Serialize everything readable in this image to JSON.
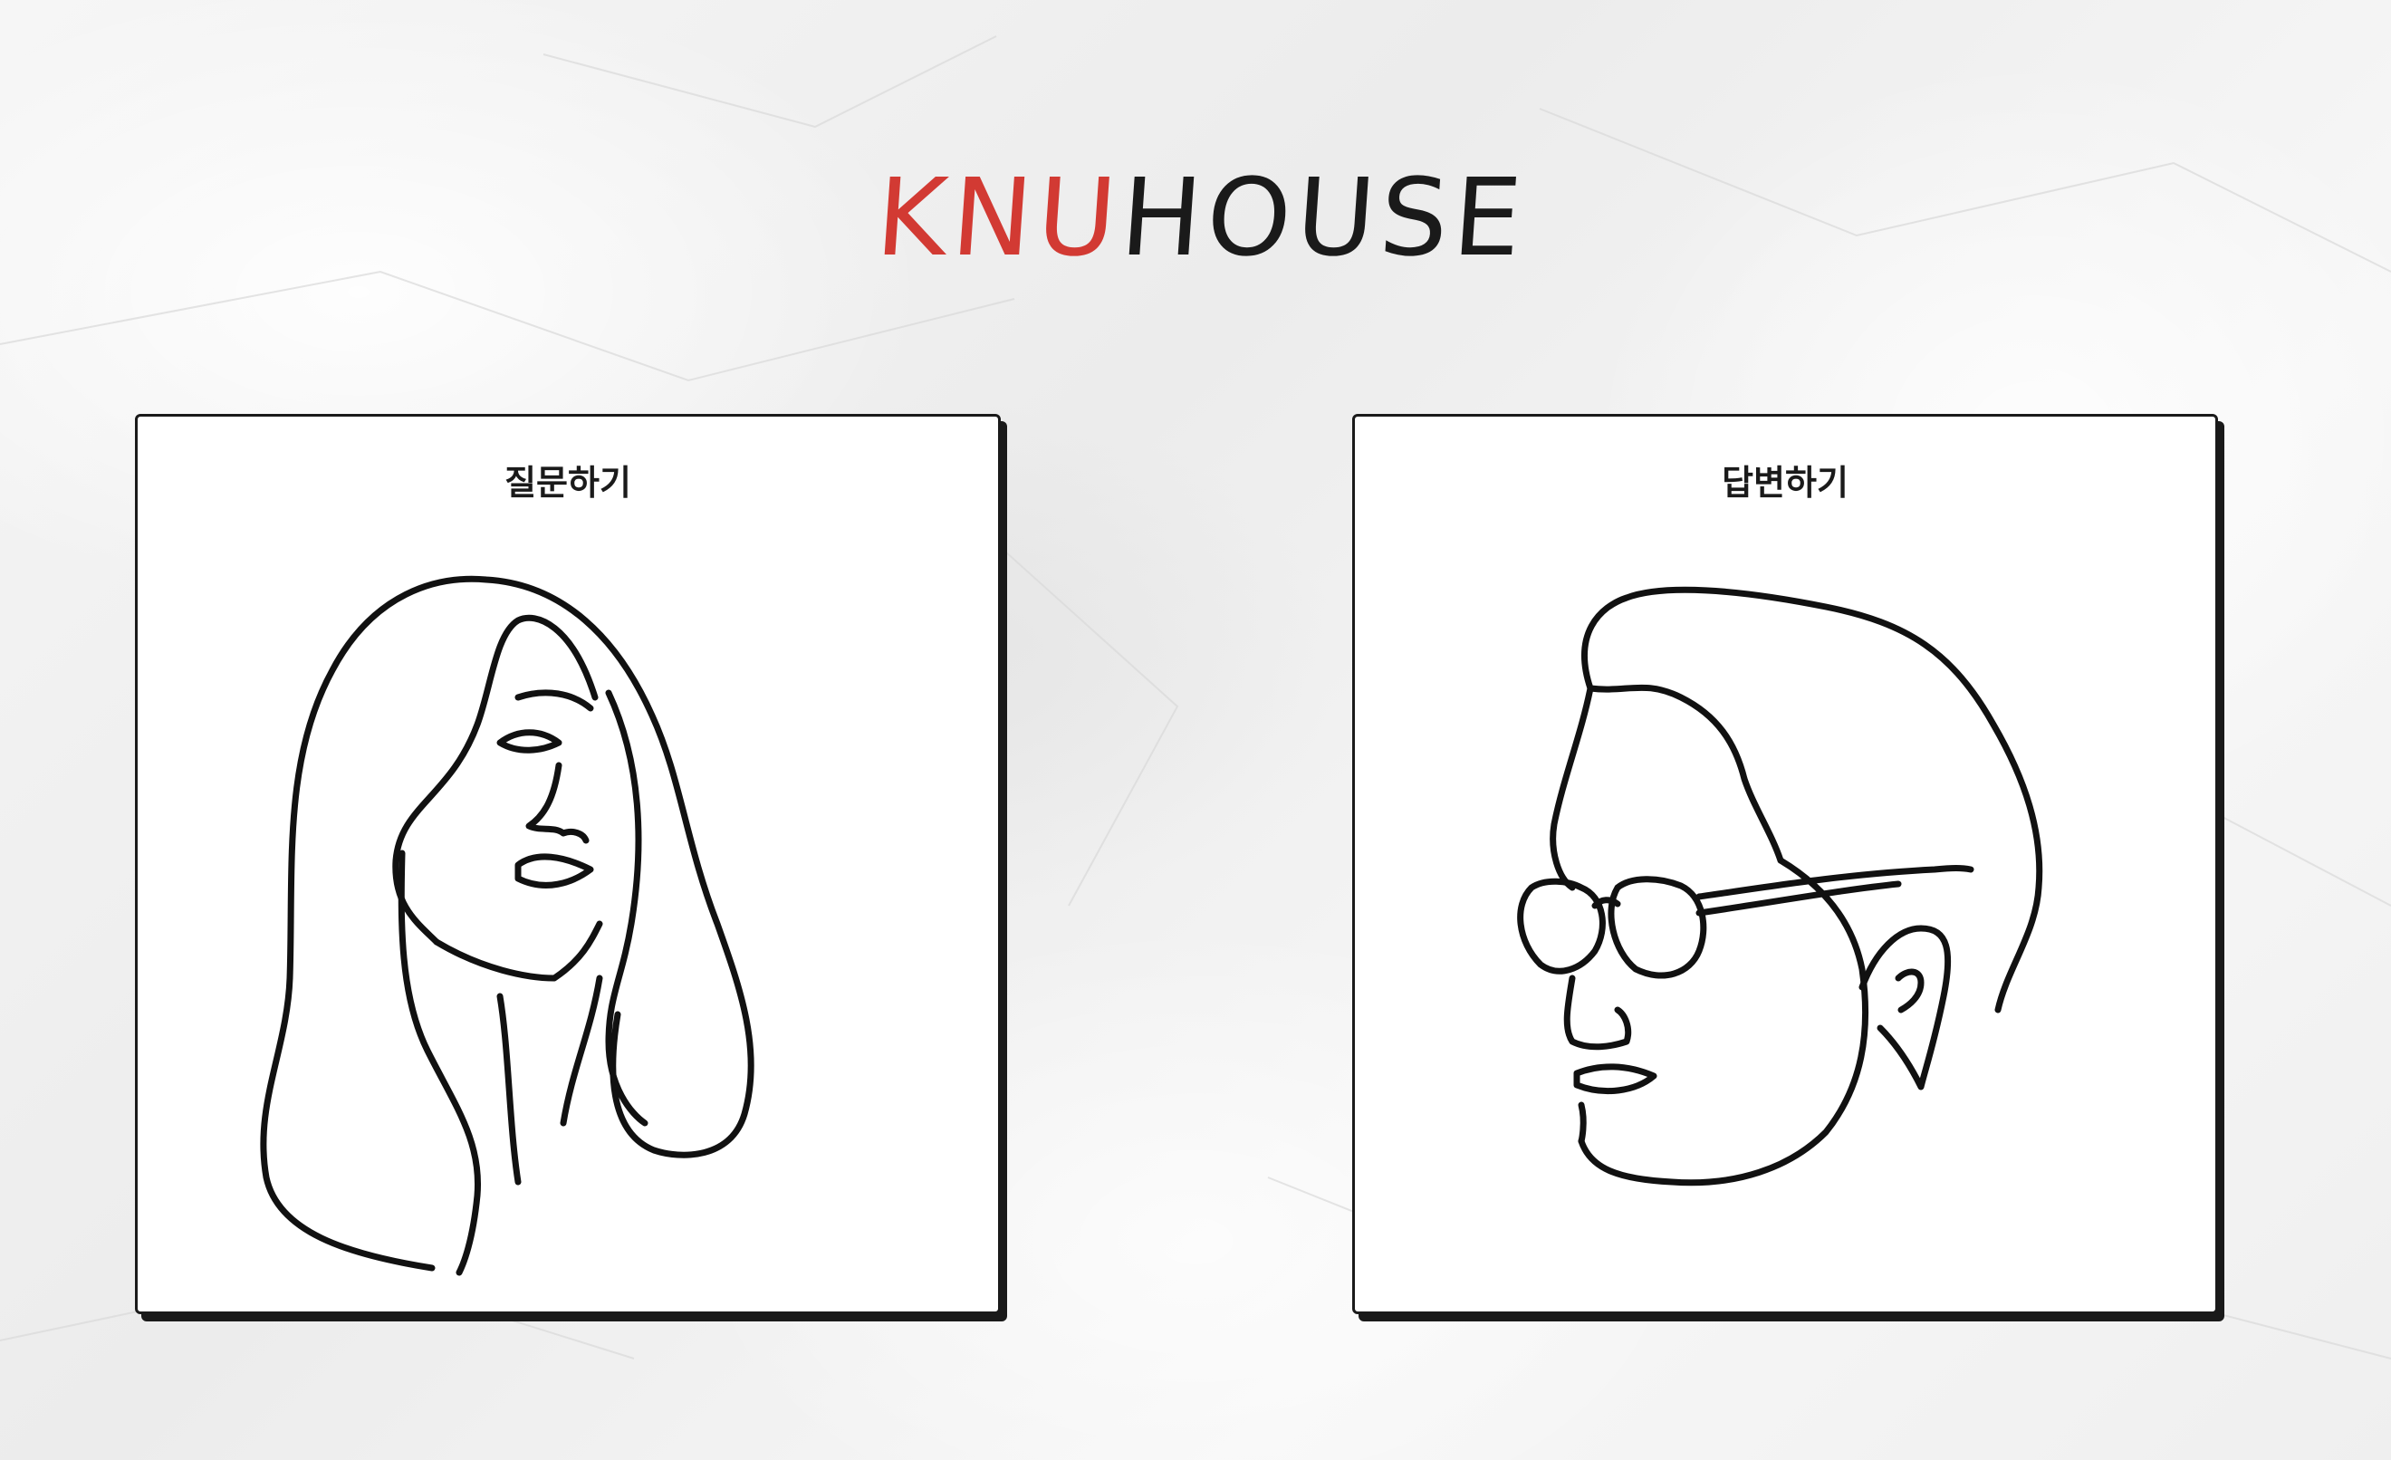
{
  "logo": {
    "part_red": "KNU",
    "part_black": "HOUSE",
    "red_color": "#d23a33",
    "black_color": "#1a1a1a"
  },
  "cards": [
    {
      "label": "질문하기",
      "illustration": "woman-line-art-icon"
    },
    {
      "label": "답변하기",
      "illustration": "man-with-sunglasses-line-art-icon"
    }
  ],
  "background": {
    "texture": "crumpled-paper"
  }
}
